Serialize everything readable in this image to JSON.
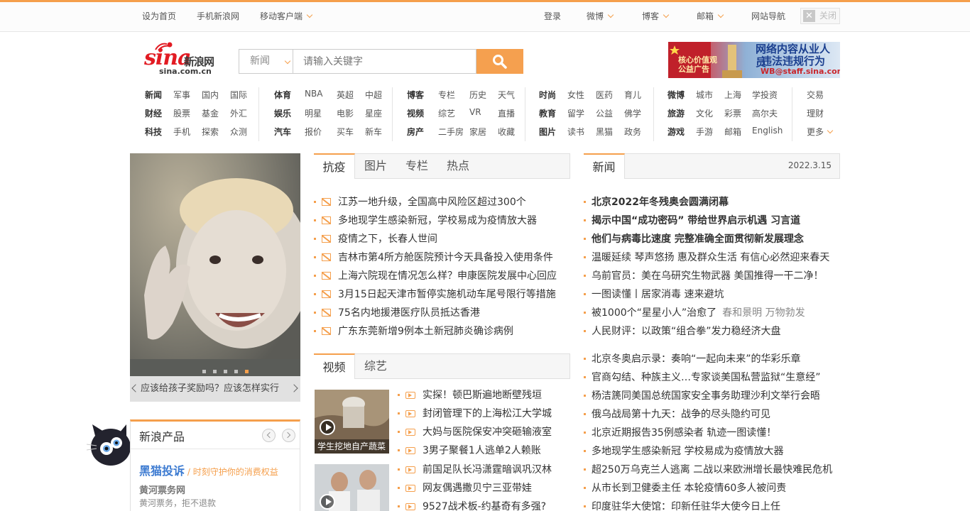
{
  "topbar": {
    "left_links": [
      "设为首页",
      "手机新浪网",
      "移动客户端"
    ],
    "right_links": [
      "登录",
      "微博",
      "博客",
      "邮箱",
      "网站导航"
    ],
    "close_label": "关闭"
  },
  "logo": {
    "brand_red": "sina",
    "brand_cn": "新浪网",
    "domain": "sina.com.cn"
  },
  "search": {
    "category": "新闻",
    "placeholder": "请输入关键字"
  },
  "ad": {
    "left_text": "核心价值观公益广告",
    "line1": "网络内容从业人员",
    "line2": "违法违规行为",
    "line3": "WB@staff.sina.com"
  },
  "nav": {
    "rows": [
      [
        "新闻",
        "军事",
        "国内",
        "国际",
        "体育",
        "NBA",
        "英超",
        "中超",
        "博客",
        "专栏",
        "历史",
        "天气",
        "时尚",
        "女性",
        "医药",
        "育儿",
        "微博",
        "城市",
        "上海",
        "学投资",
        "交易"
      ],
      [
        "财经",
        "股票",
        "基金",
        "外汇",
        "娱乐",
        "明星",
        "电影",
        "星座",
        "视频",
        "综艺",
        "VR",
        "直播",
        "教育",
        "留学",
        "公益",
        "佛学",
        "旅游",
        "文化",
        "彩票",
        "高尔夫",
        "理财"
      ],
      [
        "科技",
        "手机",
        "探索",
        "众测",
        "汽车",
        "报价",
        "买车",
        "新车",
        "房产",
        "二手房",
        "家居",
        "收藏",
        "图片",
        "读书",
        "黑猫",
        "政务",
        "游戏",
        "手游",
        "邮箱",
        "English",
        "更多"
      ]
    ]
  },
  "slideshow": {
    "caption": "应该给孩子奖励吗？应该怎样实行"
  },
  "news_tabs": {
    "tabs": [
      "抗疫",
      "图片",
      "专栏",
      "热点"
    ],
    "items": [
      "江苏一地升级，全国高中风险区超过300个",
      "多地现学生感染新冠，学校易成为疫情放大器",
      "疫情之下，长春人世间",
      "吉林市第4所方舱医院预计今天具备投入使用条件",
      "上海六院现在情况怎么样？申康医院发展中心回应",
      "3月15日起天津市暂停实施机动车尾号限行等措施",
      "75名内地援港医疗队员抵达香港",
      "广东东莞新增9例本土新冠肺炎确诊病例"
    ]
  },
  "video": {
    "tabs": [
      "视频",
      "综艺"
    ],
    "thumb_caption": "学生挖地自产蔬菜",
    "items": [
      "实探！顿巴斯遍地断壁残垣",
      "封闭管理下的上海松江大学城",
      "大妈与医院保安冲突砸输液室",
      "3男子聚餐1人逃单2人赖账",
      "前国足队长冯潇霆暗讽巩汉林",
      "网友偶遇撒贝宁三亚带娃",
      "9527战术板-约基奇有多强?"
    ]
  },
  "news_right": {
    "tab": "新闻",
    "date": "2022.3.15",
    "headlines": [
      "北京2022年冬残奥会圆满闭幕",
      "揭示中国“成功密码” 带给世界启示机遇 习言道",
      "他们与病毒比速度 完整准确全面贯彻新发展理念"
    ],
    "items1": [
      "温暖延续 琴声悠扬 惠及群众生活 有信心必然迎来春天",
      "乌前官员：美在乌研究生物武器 美国推得一干二净！",
      "一图读懂丨居家消毒 速来避坑",
      "被1000个“星星小人”治愈了",
      "人民财评：以政策“组合拳”发力稳经济大盘"
    ],
    "item4_extra": "春和景明 万物勃发",
    "items2": [
      "北京冬奥启示录：奏响“一起向未来”的华彩乐章",
      "官商勾结、种族主义…专家谈美国私营监狱“生意经”",
      "杨洁篪同美国总统国家安全事务助理沙利文举行会晤",
      "俄乌战局第十九天：战争的尽头隐约可见",
      "北京近期报告35例感染者 轨迹一图读懂！",
      "多地现学生感染新冠 学校易成为疫情放大器",
      "超250万乌克兰人逃离 二战以来欧洲增长最快难民危机",
      "从市长到卫健委主任 本轮疫情60多人被问责",
      "印度驻华大使馆：印新任驻华大使今日上任"
    ]
  },
  "products": {
    "title": "新浪产品",
    "p1_name": "黑猫投诉",
    "p1_slogan": "/ 时刻守护你的消费权益",
    "p2_name": "黄河票务网",
    "p2_desc": "黄河票务，拒不退款"
  }
}
